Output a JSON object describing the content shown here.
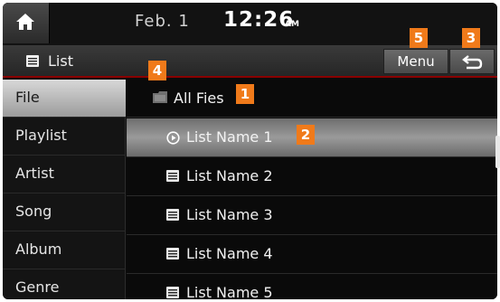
{
  "status_bar": {
    "home_icon": "home-icon",
    "date": "Feb. 1",
    "time": "12:26",
    "ampm": "AM"
  },
  "title_bar": {
    "icon": "list-icon",
    "title": "List",
    "menu_label": "Menu",
    "back_icon": "back-icon"
  },
  "categories": [
    {
      "label": "File",
      "active": true
    },
    {
      "label": "Playlist"
    },
    {
      "label": "Artist"
    },
    {
      "label": "Song"
    },
    {
      "label": "Album"
    },
    {
      "label": "Genre"
    }
  ],
  "list": {
    "all_files_label": "All Fies",
    "items": [
      {
        "label": "List Name 1",
        "icon": "play-circle-icon",
        "selected": true
      },
      {
        "label": "List Name 2",
        "icon": "list-icon"
      },
      {
        "label": "List Name 3",
        "icon": "list-icon"
      },
      {
        "label": "List Name 4",
        "icon": "list-icon"
      },
      {
        "label": "List Name 5",
        "icon": "list-icon"
      }
    ]
  },
  "callouts": [
    "1",
    "2",
    "3",
    "4",
    "5"
  ],
  "colors": {
    "accent_line": "#8a0000",
    "callout": "#f07a1a",
    "selected_row": "#9a9a9a",
    "active_tab": "#d8d8d8"
  }
}
